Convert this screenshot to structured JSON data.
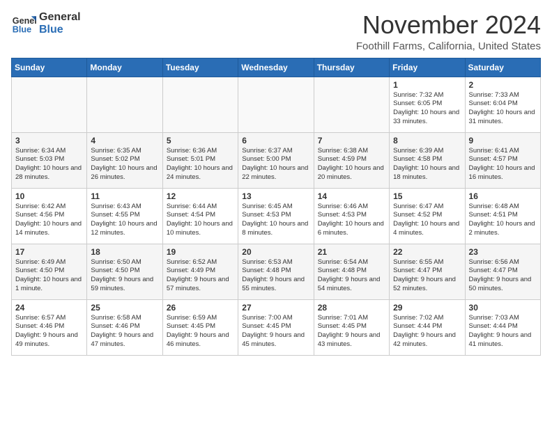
{
  "header": {
    "logo_line1": "General",
    "logo_line2": "Blue",
    "month_year": "November 2024",
    "location": "Foothill Farms, California, United States"
  },
  "days_of_week": [
    "Sunday",
    "Monday",
    "Tuesday",
    "Wednesday",
    "Thursday",
    "Friday",
    "Saturday"
  ],
  "weeks": [
    [
      {
        "day": "",
        "info": ""
      },
      {
        "day": "",
        "info": ""
      },
      {
        "day": "",
        "info": ""
      },
      {
        "day": "",
        "info": ""
      },
      {
        "day": "",
        "info": ""
      },
      {
        "day": "1",
        "info": "Sunrise: 7:32 AM\nSunset: 6:05 PM\nDaylight: 10 hours and 33 minutes."
      },
      {
        "day": "2",
        "info": "Sunrise: 7:33 AM\nSunset: 6:04 PM\nDaylight: 10 hours and 31 minutes."
      }
    ],
    [
      {
        "day": "3",
        "info": "Sunrise: 6:34 AM\nSunset: 5:03 PM\nDaylight: 10 hours and 28 minutes."
      },
      {
        "day": "4",
        "info": "Sunrise: 6:35 AM\nSunset: 5:02 PM\nDaylight: 10 hours and 26 minutes."
      },
      {
        "day": "5",
        "info": "Sunrise: 6:36 AM\nSunset: 5:01 PM\nDaylight: 10 hours and 24 minutes."
      },
      {
        "day": "6",
        "info": "Sunrise: 6:37 AM\nSunset: 5:00 PM\nDaylight: 10 hours and 22 minutes."
      },
      {
        "day": "7",
        "info": "Sunrise: 6:38 AM\nSunset: 4:59 PM\nDaylight: 10 hours and 20 minutes."
      },
      {
        "day": "8",
        "info": "Sunrise: 6:39 AM\nSunset: 4:58 PM\nDaylight: 10 hours and 18 minutes."
      },
      {
        "day": "9",
        "info": "Sunrise: 6:41 AM\nSunset: 4:57 PM\nDaylight: 10 hours and 16 minutes."
      }
    ],
    [
      {
        "day": "10",
        "info": "Sunrise: 6:42 AM\nSunset: 4:56 PM\nDaylight: 10 hours and 14 minutes."
      },
      {
        "day": "11",
        "info": "Sunrise: 6:43 AM\nSunset: 4:55 PM\nDaylight: 10 hours and 12 minutes."
      },
      {
        "day": "12",
        "info": "Sunrise: 6:44 AM\nSunset: 4:54 PM\nDaylight: 10 hours and 10 minutes."
      },
      {
        "day": "13",
        "info": "Sunrise: 6:45 AM\nSunset: 4:53 PM\nDaylight: 10 hours and 8 minutes."
      },
      {
        "day": "14",
        "info": "Sunrise: 6:46 AM\nSunset: 4:53 PM\nDaylight: 10 hours and 6 minutes."
      },
      {
        "day": "15",
        "info": "Sunrise: 6:47 AM\nSunset: 4:52 PM\nDaylight: 10 hours and 4 minutes."
      },
      {
        "day": "16",
        "info": "Sunrise: 6:48 AM\nSunset: 4:51 PM\nDaylight: 10 hours and 2 minutes."
      }
    ],
    [
      {
        "day": "17",
        "info": "Sunrise: 6:49 AM\nSunset: 4:50 PM\nDaylight: 10 hours and 1 minute."
      },
      {
        "day": "18",
        "info": "Sunrise: 6:50 AM\nSunset: 4:50 PM\nDaylight: 9 hours and 59 minutes."
      },
      {
        "day": "19",
        "info": "Sunrise: 6:52 AM\nSunset: 4:49 PM\nDaylight: 9 hours and 57 minutes."
      },
      {
        "day": "20",
        "info": "Sunrise: 6:53 AM\nSunset: 4:48 PM\nDaylight: 9 hours and 55 minutes."
      },
      {
        "day": "21",
        "info": "Sunrise: 6:54 AM\nSunset: 4:48 PM\nDaylight: 9 hours and 54 minutes."
      },
      {
        "day": "22",
        "info": "Sunrise: 6:55 AM\nSunset: 4:47 PM\nDaylight: 9 hours and 52 minutes."
      },
      {
        "day": "23",
        "info": "Sunrise: 6:56 AM\nSunset: 4:47 PM\nDaylight: 9 hours and 50 minutes."
      }
    ],
    [
      {
        "day": "24",
        "info": "Sunrise: 6:57 AM\nSunset: 4:46 PM\nDaylight: 9 hours and 49 minutes."
      },
      {
        "day": "25",
        "info": "Sunrise: 6:58 AM\nSunset: 4:46 PM\nDaylight: 9 hours and 47 minutes."
      },
      {
        "day": "26",
        "info": "Sunrise: 6:59 AM\nSunset: 4:45 PM\nDaylight: 9 hours and 46 minutes."
      },
      {
        "day": "27",
        "info": "Sunrise: 7:00 AM\nSunset: 4:45 PM\nDaylight: 9 hours and 45 minutes."
      },
      {
        "day": "28",
        "info": "Sunrise: 7:01 AM\nSunset: 4:45 PM\nDaylight: 9 hours and 43 minutes."
      },
      {
        "day": "29",
        "info": "Sunrise: 7:02 AM\nSunset: 4:44 PM\nDaylight: 9 hours and 42 minutes."
      },
      {
        "day": "30",
        "info": "Sunrise: 7:03 AM\nSunset: 4:44 PM\nDaylight: 9 hours and 41 minutes."
      }
    ]
  ]
}
